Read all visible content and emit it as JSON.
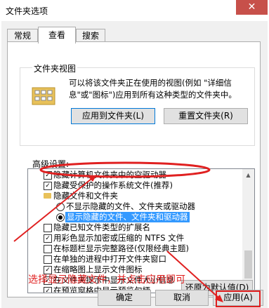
{
  "window": {
    "title": "文件夹选项",
    "close_glyph": "✕"
  },
  "tabs": [
    "常规",
    "查看",
    "搜索"
  ],
  "folder_views": {
    "legend": "文件夹视图",
    "description": "可以将该文件夹正在使用的视图(例如 \"详细信息\"或\"图标\")应用到所有这种类型的文件夹中。",
    "apply_button": "应用到文件夹(L)",
    "reset_button": "重置文件夹(R)"
  },
  "advanced": {
    "label": "高级设置:",
    "items": [
      {
        "kind": "checkbox",
        "checked": true,
        "label": "隐藏计算机文件夹中的空驱动器"
      },
      {
        "kind": "checkbox",
        "checked": true,
        "label": "隐藏受保护的操作系统文件(推荐)"
      },
      {
        "kind": "folder",
        "label": "隐藏文件和文件夹"
      },
      {
        "kind": "radio",
        "checked": false,
        "label": "不显示隐藏的文件、文件夹或驱动器"
      },
      {
        "kind": "radio",
        "checked": true,
        "selected": true,
        "label": "显示隐藏的文件、文件夹和驱动器"
      },
      {
        "kind": "checkbox",
        "checked": false,
        "label": "隐藏已知文件类型的扩展名"
      },
      {
        "kind": "checkbox",
        "checked": true,
        "label": "用彩色显示加密或压缩的 NTFS 文件"
      },
      {
        "kind": "checkbox",
        "checked": false,
        "label": "在标题栏显示完整路径(仅限经典主题)"
      },
      {
        "kind": "checkbox",
        "checked": false,
        "label": "在单独的进程中打开文件夹窗口"
      },
      {
        "kind": "checkbox",
        "checked": true,
        "label": "在缩略图上显示文件图标"
      },
      {
        "kind": "checkbox",
        "checked": true,
        "label": "在文件夹提示中显示文件大小信息"
      },
      {
        "kind": "checkbox",
        "checked": true,
        "label": "在预览窗格中显示预览句柄"
      }
    ],
    "restore_button": "还原为默认值(D)"
  },
  "footer": {
    "ok": "确定",
    "cancel": "取消",
    "apply": "应用(A)"
  },
  "annotation": {
    "text": "选择显示隐藏文件，并点击应用即可",
    "color": "#e02020"
  }
}
